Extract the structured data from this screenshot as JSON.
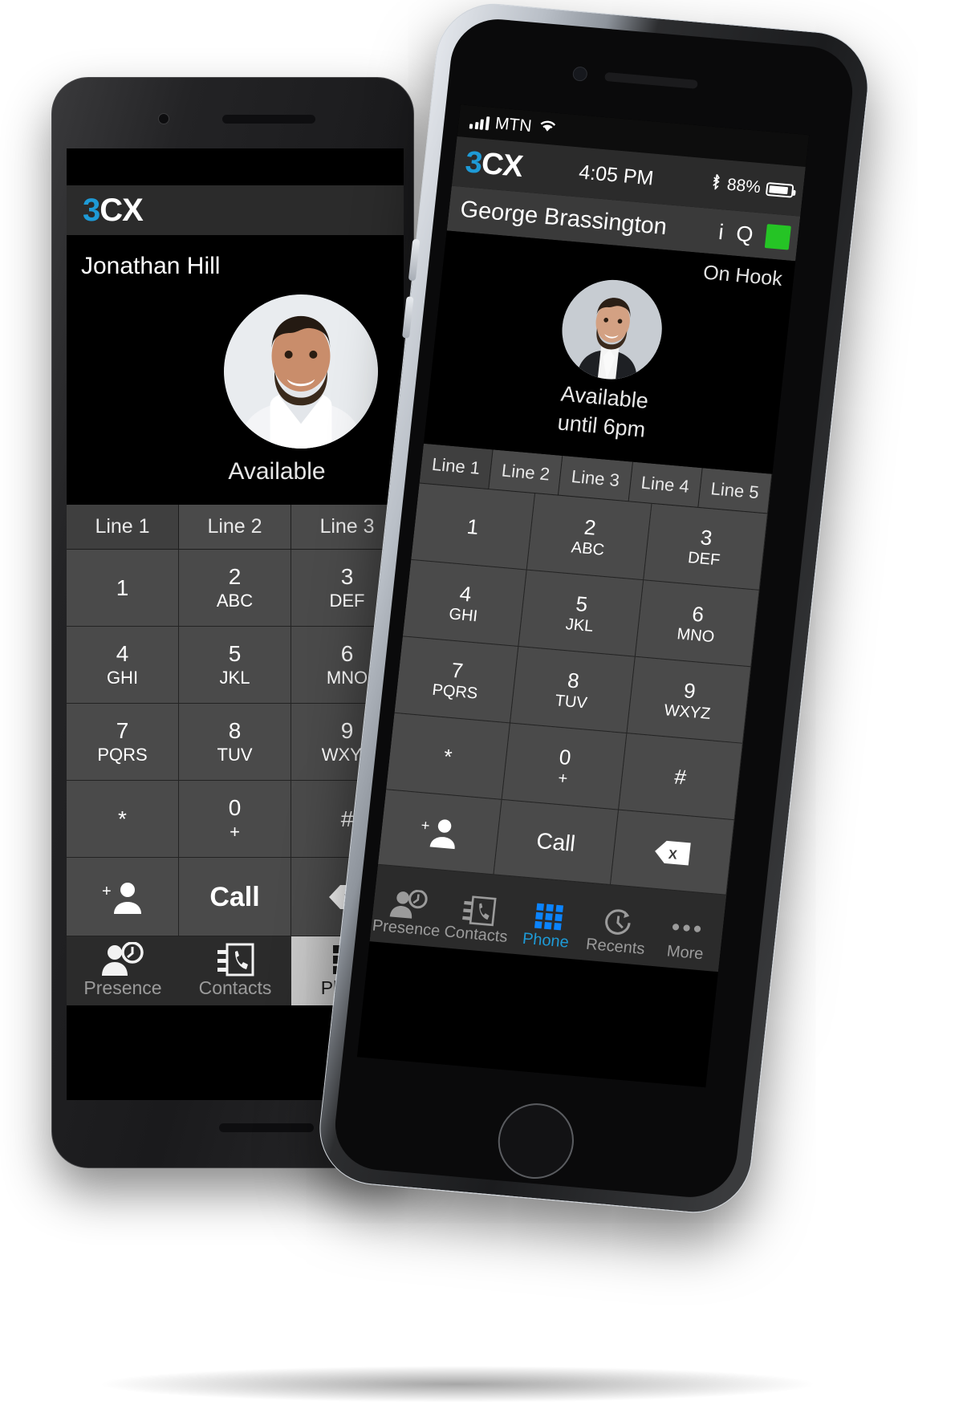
{
  "left_phone": {
    "app": {
      "brand_3": "3",
      "brand_cx": "CX"
    },
    "contact_name": "Jonathan Hill",
    "presence_status": "Available",
    "lines": [
      "Line 1",
      "Line 2",
      "Line 3"
    ],
    "keypad": [
      {
        "num": "1",
        "alpha": ""
      },
      {
        "num": "2",
        "alpha": "ABC"
      },
      {
        "num": "3",
        "alpha": "DEF"
      },
      {
        "num": "4",
        "alpha": "GHI"
      },
      {
        "num": "5",
        "alpha": "JKL"
      },
      {
        "num": "6",
        "alpha": "MNO"
      },
      {
        "num": "7",
        "alpha": "PQRS"
      },
      {
        "num": "8",
        "alpha": "TUV"
      },
      {
        "num": "9",
        "alpha": "WXYZ"
      },
      {
        "num": "*",
        "alpha": ""
      },
      {
        "num": "0",
        "alpha": "+"
      },
      {
        "num": "#",
        "alpha": ""
      }
    ],
    "actions": {
      "add_contact": "add-contact-icon",
      "call_label": "Call",
      "backspace": "backspace-icon"
    },
    "tabs": [
      {
        "label": "Presence",
        "icon": "presence-icon",
        "active": false
      },
      {
        "label": "Contacts",
        "icon": "contacts-icon",
        "active": false
      },
      {
        "label": "Phone",
        "icon": "keypad-icon",
        "active": true
      }
    ]
  },
  "right_phone": {
    "status_bar": {
      "signal_icon": "signal-bars-icon",
      "carrier": "MTN",
      "wifi_icon": "wifi-icon"
    },
    "app": {
      "brand_3": "3",
      "brand_cx": "CX"
    },
    "time": "4:05 PM",
    "bluetooth_icon": "bluetooth-icon",
    "battery_percent": "88%",
    "battery_icon": "battery-icon",
    "contact_name": "George Brassington",
    "info_icon": "info-icon",
    "search_icon": "search-q-icon",
    "status_square": "available-green-square",
    "hook_status": "On Hook",
    "presence_status": "Available",
    "presence_until": "until 6pm",
    "lines": [
      "Line 1",
      "Line 2",
      "Line 3",
      "Line 4",
      "Line 5"
    ],
    "keypad": [
      {
        "num": "1",
        "alpha": ""
      },
      {
        "num": "2",
        "alpha": "ABC"
      },
      {
        "num": "3",
        "alpha": "DEF"
      },
      {
        "num": "4",
        "alpha": "GHI"
      },
      {
        "num": "5",
        "alpha": "JKL"
      },
      {
        "num": "6",
        "alpha": "MNO"
      },
      {
        "num": "7",
        "alpha": "PQRS"
      },
      {
        "num": "8",
        "alpha": "TUV"
      },
      {
        "num": "9",
        "alpha": "WXYZ"
      },
      {
        "num": "*",
        "alpha": ""
      },
      {
        "num": "0",
        "alpha": "+"
      },
      {
        "num": "#",
        "alpha": ""
      }
    ],
    "actions": {
      "add_contact": "add-contact-icon",
      "call_label": "Call",
      "backspace": "backspace-icon"
    },
    "tabs": [
      {
        "label": "Presence",
        "icon": "presence-icon",
        "active": false
      },
      {
        "label": "Contacts",
        "icon": "contacts-icon",
        "active": false
      },
      {
        "label": "Phone",
        "icon": "keypad-icon",
        "active": true
      },
      {
        "label": "Recents",
        "icon": "recents-clock-icon",
        "active": false
      },
      {
        "label": "More",
        "icon": "more-dots-icon",
        "active": false
      }
    ]
  },
  "colors": {
    "brand_blue": "#1e9ad6",
    "accent_blue": "#0b84ff",
    "available_green": "#25c425",
    "key_bg": "#4a4a4a",
    "bar_bg": "#2b2b2b"
  }
}
